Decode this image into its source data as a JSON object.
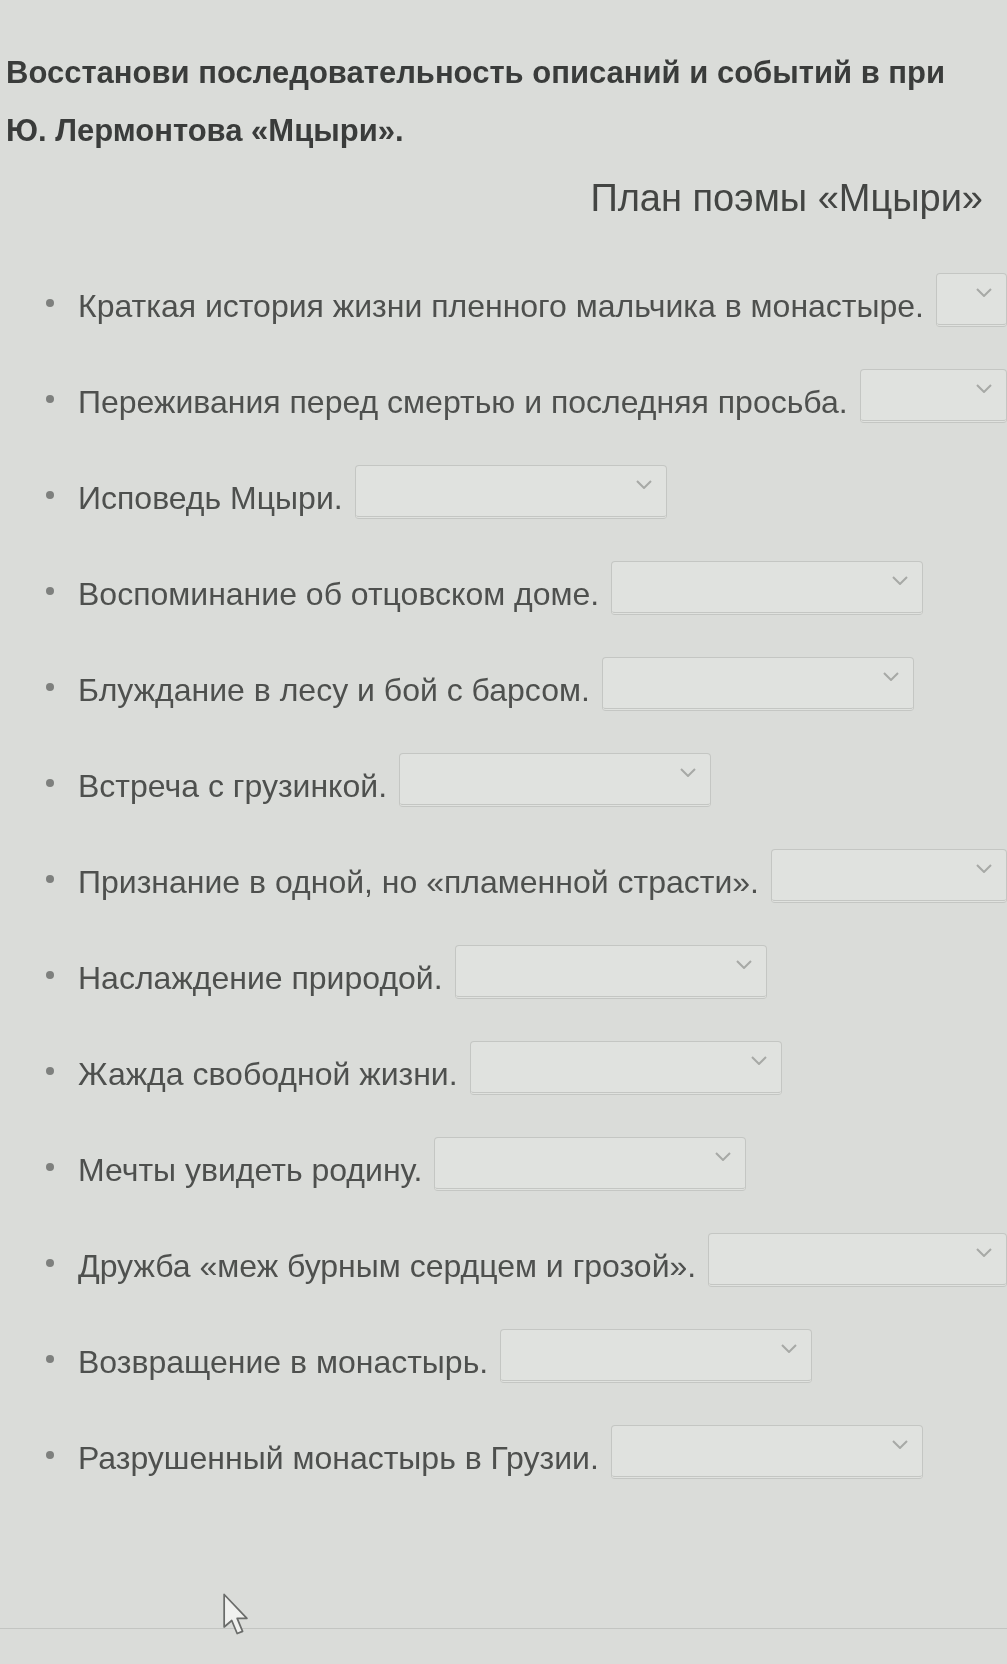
{
  "instruction": {
    "lines": [
      "Восстанови последовательность описаний и событий в при",
      "Ю. Лермонтова «Мцыри»."
    ]
  },
  "plan": {
    "title": "План поэмы «Мцыри»",
    "items": [
      {
        "text": "Краткая история жизни пленного мальчика в монастыре."
      },
      {
        "text": "Переживания перед смертью и последняя просьба."
      },
      {
        "text": "Исповедь Мцыри."
      },
      {
        "text": "Воспоминание об отцовском доме."
      },
      {
        "text": "Блуждание в лесу и бой с барсом."
      },
      {
        "text": "Встреча с грузинкой."
      },
      {
        "text": "Признание в одной, но «пламенной страсти»."
      },
      {
        "text": "Наслаждение природой."
      },
      {
        "text": "Жажда свободной жизни."
      },
      {
        "text": "Мечты увидеть родину."
      },
      {
        "text": "Дружба «меж бурным сердцем и грозой»."
      },
      {
        "text": "Возвращение в монастырь."
      },
      {
        "text": "Разрушенный монастырь в Грузии."
      }
    ]
  }
}
